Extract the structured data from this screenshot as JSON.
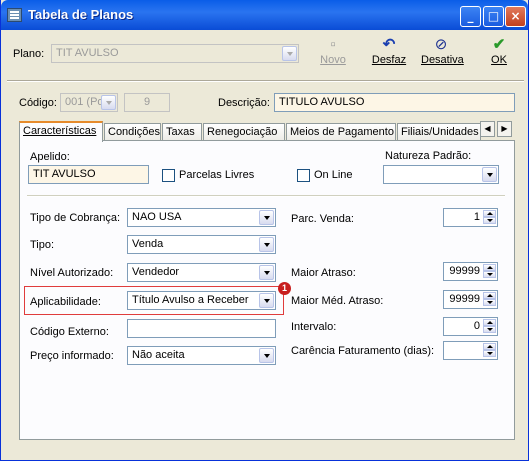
{
  "window": {
    "title": "Tabela de Planos"
  },
  "toolbar": {
    "plano_label": "Plano:",
    "plano_value": "TIT AVULSO",
    "novo": "Novo",
    "desfaz": "Desfaz",
    "desativa": "Desativa",
    "ok": "OK"
  },
  "header": {
    "codigo_label": "Código:",
    "codigo_select": "001 (Po:",
    "codigo_num": "9",
    "descricao_label": "Descrição:",
    "descricao_value": "TITULO AVULSO"
  },
  "tabs": [
    "Características",
    "Condições",
    "Taxas",
    "Renegociação",
    "Meios de Pagamento",
    "Filiais/Unidades"
  ],
  "caracteristicas": {
    "apelido_label": "Apelido:",
    "apelido_value": "TIT AVULSO",
    "parcelas_livres": "Parcelas Livres",
    "on_line": "On Line",
    "natureza_label": "Natureza Padrão:",
    "natureza_value": "",
    "tipo_cobranca_label": "Tipo de Cobrança:",
    "tipo_cobranca_value": "NAO USA",
    "tipo_label": "Tipo:",
    "tipo_value": "Venda",
    "nivel_label": "Nível Autorizado:",
    "nivel_value": "Vendedor",
    "aplicabilidade_label": "Aplicabilidade:",
    "aplicabilidade_value": "Título Avulso a Receber",
    "codigo_externo_label": "Código Externo:",
    "codigo_externo_value": "",
    "preco_label": "Preço informado:",
    "preco_value": "Não aceita",
    "parc_venda_label": "Parc. Venda:",
    "parc_venda_value": "1",
    "maior_atraso_label": "Maior Atraso:",
    "maior_atraso_value": "99999",
    "maior_med_label": "Maior Méd. Atraso:",
    "maior_med_value": "99999",
    "intervalo_label": "Intervalo:",
    "intervalo_value": "0",
    "carencia_label": "Carência Faturamento (dias):",
    "carencia_value": ""
  },
  "annotation": {
    "badge": "1"
  }
}
